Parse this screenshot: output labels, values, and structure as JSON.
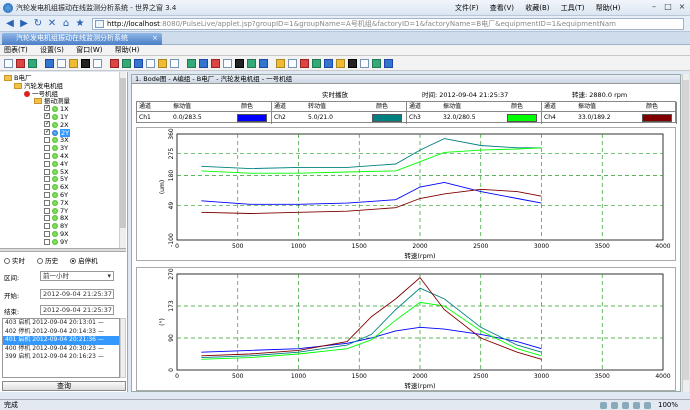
{
  "browser": {
    "title": "汽轮发电机组振动在线监测分析系统 - 世界之窗 3.4",
    "menus": [
      "文件(F)",
      "查看(V)",
      "收藏(B)",
      "工具(T)",
      "帮助(H)"
    ],
    "url_prefix": "http://localhost",
    "url_rest": ":8080/PulseLive/applet.jsp?groupID=1&groupName=A号机组&factoryID=1&factoryName=B电厂&equipmentID=1&equipmentNam",
    "tab_label": "汽轮发电机组振动在线监测分析系统",
    "tab_close": "×",
    "status_text": "完成",
    "zoom": "100%"
  },
  "app": {
    "menus": [
      "图表(T)",
      "设置(S)",
      "窗口(W)",
      "帮助(H)"
    ]
  },
  "tree": {
    "items": [
      {
        "label": "B电厂",
        "level": 0,
        "kind": "folder"
      },
      {
        "label": "汽轮发电机组",
        "level": 1,
        "kind": "folder"
      },
      {
        "label": "一号机组",
        "level": 2,
        "kind": "red"
      },
      {
        "label": "振动测量",
        "level": 3,
        "kind": "folder"
      },
      {
        "label": "1X",
        "level": 4,
        "kind": "ch",
        "checked": true
      },
      {
        "label": "1Y",
        "level": 4,
        "kind": "ch",
        "checked": true
      },
      {
        "label": "2X",
        "level": 4,
        "kind": "ch",
        "checked": true
      },
      {
        "label": "2Y",
        "level": 4,
        "kind": "ch",
        "checked": true,
        "selected": true
      },
      {
        "label": "3X",
        "level": 4,
        "kind": "ch",
        "checked": false
      },
      {
        "label": "3Y",
        "level": 4,
        "kind": "ch",
        "checked": false
      },
      {
        "label": "4X",
        "level": 4,
        "kind": "ch",
        "checked": false
      },
      {
        "label": "4Y",
        "level": 4,
        "kind": "ch",
        "checked": false
      },
      {
        "label": "5X",
        "level": 4,
        "kind": "ch",
        "checked": false
      },
      {
        "label": "5Y",
        "level": 4,
        "kind": "ch",
        "checked": false
      },
      {
        "label": "6X",
        "level": 4,
        "kind": "ch",
        "checked": false
      },
      {
        "label": "6Y",
        "level": 4,
        "kind": "ch",
        "checked": false
      },
      {
        "label": "7X",
        "level": 4,
        "kind": "ch",
        "checked": false
      },
      {
        "label": "7Y",
        "level": 4,
        "kind": "ch",
        "checked": false
      },
      {
        "label": "8X",
        "level": 4,
        "kind": "ch",
        "checked": false
      },
      {
        "label": "8Y",
        "level": 4,
        "kind": "ch",
        "checked": false
      },
      {
        "label": "9X",
        "level": 4,
        "kind": "ch",
        "checked": false
      },
      {
        "label": "9Y",
        "level": 4,
        "kind": "ch",
        "checked": false
      }
    ]
  },
  "query": {
    "modes": [
      "实时",
      "历史",
      "启停机"
    ],
    "mode_selected": 2,
    "range_label": "区间:",
    "range_value": "前一小时",
    "start_label": "开始:",
    "start_value": "2012-09-04 21:25:37",
    "end_label": "结束:",
    "end_value": "2012-09-04 21:25:37",
    "records": [
      "403 启机 2012-09-04 20:13:01 —",
      "402 停机 2012-09-04 20:14:33 —",
      "401 启机 2012-09-04 20:21:36 —",
      "400 停机 2012-09-04 20:30:23 —",
      "399 启机 2012-09-04 20:16:23 —"
    ],
    "record_selected": 2,
    "button": "查询"
  },
  "panel": {
    "title": "1. Bode图 - A编组 - B电厂 - 汽轮发电机组 - 一号机组",
    "mode_text": "实时播放",
    "time_text": "时间: 2012-09-04 21:25:37",
    "speed_text": "转速: 2880.0 rpm",
    "channels": [
      {
        "h1": "通道",
        "h2": "振动值",
        "h3": "颜色",
        "name": "Ch1",
        "value": "0.0/283.5",
        "color": "#0000ff"
      },
      {
        "h1": "通道",
        "h2": "转动值",
        "h3": "颜色",
        "name": "Ch2",
        "value": "5.0/21.0",
        "color": "#008080"
      },
      {
        "h1": "通道",
        "h2": "振动值",
        "h3": "颜色",
        "name": "Ch3",
        "value": "32.0/280.5",
        "color": "#00ff00"
      },
      {
        "h1": "通道",
        "h2": "振动值",
        "h3": "颜色",
        "name": "Ch4",
        "value": "33.0/189.2",
        "color": "#800000"
      }
    ]
  },
  "chart_data": [
    {
      "type": "line",
      "xlabel": "转速(rpm)",
      "ylabel": "(um)",
      "xlim": [
        0,
        4000
      ],
      "ylim": [
        -100,
        360
      ],
      "xticks": [
        0,
        500,
        1000,
        1500,
        2000,
        2500,
        3000,
        3500,
        4000
      ],
      "yticks": [
        -100,
        49,
        180,
        275,
        360
      ],
      "ytick_labels": [
        "-100",
        "49",
        "180",
        "275",
        "360"
      ],
      "series": [
        {
          "color": "#0000ff",
          "x": [
            200,
            600,
            1000,
            1400,
            1800,
            2000,
            2200,
            2500,
            2800,
            3000
          ],
          "y": [
            70,
            55,
            55,
            60,
            75,
            130,
            150,
            110,
            80,
            60
          ]
        },
        {
          "color": "#008080",
          "x": [
            200,
            600,
            1000,
            1400,
            1800,
            2000,
            2200,
            2500,
            2800,
            3000
          ],
          "y": [
            220,
            210,
            215,
            215,
            230,
            290,
            340,
            310,
            300,
            300
          ]
        },
        {
          "color": "#00ff00",
          "x": [
            200,
            600,
            1000,
            1400,
            1800,
            2000,
            2200,
            2500,
            2800,
            3000
          ],
          "y": [
            200,
            190,
            190,
            195,
            200,
            240,
            280,
            290,
            295,
            300
          ]
        },
        {
          "color": "#800000",
          "x": [
            200,
            600,
            1000,
            1400,
            1800,
            2000,
            2200,
            2500,
            2800,
            3000
          ],
          "y": [
            20,
            15,
            20,
            25,
            40,
            80,
            100,
            120,
            110,
            90
          ]
        }
      ]
    },
    {
      "type": "line",
      "xlabel": "转速(rpm)",
      "ylabel": "(°)",
      "xlim": [
        0,
        4000
      ],
      "ylim": [
        0,
        270
      ],
      "xticks": [
        0,
        500,
        1000,
        1500,
        2000,
        2500,
        3000,
        3500,
        4000
      ],
      "yticks": [
        0,
        90,
        180,
        270
      ],
      "ytick_labels": [
        "0",
        "90",
        "173",
        "270"
      ],
      "series": [
        {
          "color": "#0000ff",
          "x": [
            200,
            600,
            1000,
            1400,
            1600,
            1800,
            2000,
            2200,
            2500,
            2800,
            3000
          ],
          "y": [
            50,
            55,
            60,
            75,
            90,
            110,
            120,
            115,
            100,
            80,
            60
          ]
        },
        {
          "color": "#008080",
          "x": [
            200,
            600,
            1000,
            1400,
            1600,
            1800,
            2000,
            2200,
            2500,
            2800,
            3000
          ],
          "y": [
            35,
            40,
            50,
            70,
            100,
            170,
            230,
            200,
            120,
            70,
            50
          ]
        },
        {
          "color": "#00ff00",
          "x": [
            200,
            600,
            1000,
            1400,
            1600,
            1800,
            2000,
            2200,
            2500,
            2800,
            3000
          ],
          "y": [
            30,
            35,
            45,
            60,
            85,
            140,
            190,
            180,
            110,
            60,
            40
          ]
        },
        {
          "color": "#800000",
          "x": [
            200,
            600,
            1000,
            1400,
            1600,
            1800,
            2000,
            2200,
            2500,
            2800,
            3000
          ],
          "y": [
            40,
            45,
            55,
            80,
            150,
            200,
            260,
            170,
            90,
            50,
            30
          ]
        }
      ]
    }
  ]
}
